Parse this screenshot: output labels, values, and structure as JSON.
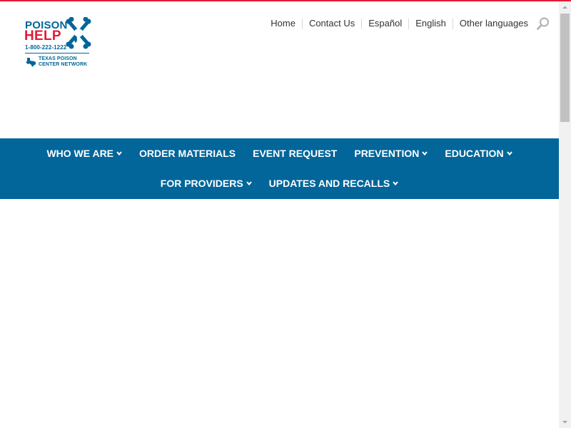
{
  "colors": {
    "brand_blue": "#00669a",
    "brand_red": "#e31b37",
    "top_border": "#e31b37",
    "nav_bg": "#02669a",
    "nav_text": "#ffffff",
    "util_text": "#333333"
  },
  "logo": {
    "line1": "POISON",
    "line2": "HELP",
    "phone": "1-800-222-1222",
    "network_line1": "TEXAS POISON",
    "network_line2": "CENTER NETWORK",
    "icons": [
      "skull-crossbones-icon",
      "texas-state-icon"
    ]
  },
  "utility_nav": {
    "links": [
      "Home",
      "Contact Us",
      "Español",
      "English",
      "Other languages"
    ],
    "search_icon": "search-icon"
  },
  "main_nav": {
    "row1": [
      {
        "label": "WHO WE ARE",
        "dropdown": true
      },
      {
        "label": "ORDER MATERIALS",
        "dropdown": false
      },
      {
        "label": "EVENT REQUEST",
        "dropdown": false
      },
      {
        "label": "PREVENTION",
        "dropdown": true
      },
      {
        "label": "EDUCATION",
        "dropdown": true
      }
    ],
    "row2": [
      {
        "label": "FOR PROVIDERS",
        "dropdown": true
      },
      {
        "label": "UPDATES AND RECALLS",
        "dropdown": true
      }
    ]
  },
  "scrollbar": {
    "position_fraction": 0
  }
}
